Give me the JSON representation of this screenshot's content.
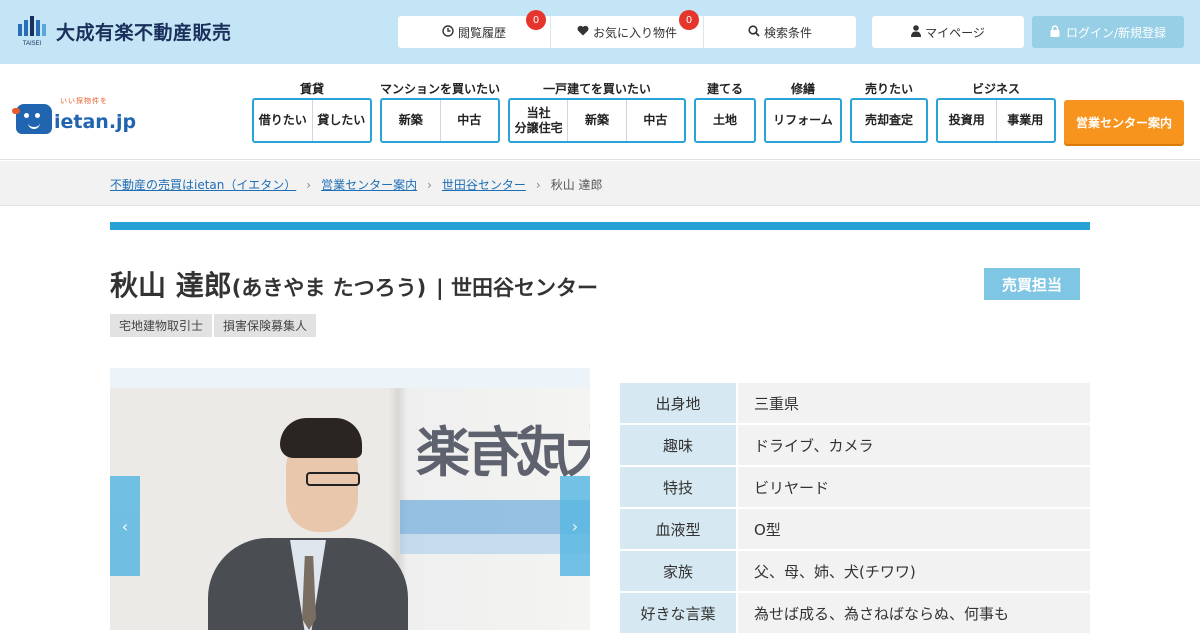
{
  "header": {
    "brand_name": "大成有楽不動産販売",
    "brand_sub": "TAISEI",
    "history": {
      "label": "閲覧履歴",
      "count": "0"
    },
    "favorites": {
      "label": "お気に入り物件",
      "count": "0"
    },
    "search_conditions": "検索条件",
    "mypage": "マイページ",
    "login": "ログイン/新規登録"
  },
  "nav": {
    "logo_text": "ietan.jp",
    "logo_tagline": "いい探物件を",
    "groups": [
      {
        "label": "賃貸",
        "items": [
          "借りたい",
          "貸したい"
        ]
      },
      {
        "label": "マンションを買いたい",
        "items": [
          "新築",
          "中古"
        ]
      },
      {
        "label": "一戸建てを買いたい",
        "items": [
          "当社\n分譲住宅",
          "新築",
          "中古"
        ]
      },
      {
        "label": "建てる",
        "items": [
          "土地"
        ]
      },
      {
        "label": "修繕",
        "items": [
          "リフォーム"
        ]
      },
      {
        "label": "売りたい",
        "items": [
          "売却査定"
        ]
      },
      {
        "label": "ビジネス",
        "items": [
          "投資用",
          "事業用"
        ]
      }
    ],
    "center_button": "営業センター案内"
  },
  "breadcrumb": [
    "不動産の売買はietan（イエタン）",
    "営業センター案内",
    "世田谷センター",
    "秋山 達郎"
  ],
  "profile": {
    "name": "秋山 達郎",
    "kana": "(あきやま たつろう)",
    "center": "| 世田谷センター",
    "role": "売買担当",
    "qualifications": [
      "宅地建物取引士",
      "損害保険募集人"
    ],
    "photo_sign": "大成有楽",
    "rows": [
      {
        "label": "出身地",
        "value": "三重県"
      },
      {
        "label": "趣味",
        "value": "ドライブ、カメラ"
      },
      {
        "label": "特技",
        "value": "ビリヤード"
      },
      {
        "label": "血液型",
        "value": "O型"
      },
      {
        "label": "家族",
        "value": "父、母、姉、犬(チワワ)"
      },
      {
        "label": "好きな言葉",
        "value": "為せば成る、為さねばならぬ、何事も"
      }
    ]
  },
  "colors": {
    "topbar_bg": "#c3e5f5",
    "accent_blue": "#27a0d6",
    "orange": "#f7941d",
    "badge_red": "#e5352c",
    "role_bg": "#7fc6e4"
  },
  "icons": {
    "history": "clock-icon",
    "favorites": "heart-icon",
    "search": "search-icon",
    "mypage": "user-icon",
    "login": "lock-icon",
    "prev": "chevron-left-icon",
    "next": "chevron-right-icon"
  }
}
